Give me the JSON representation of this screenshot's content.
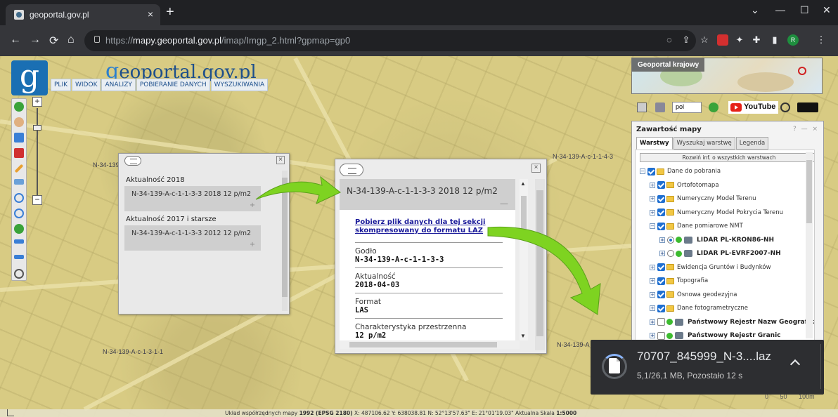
{
  "browser": {
    "tab_title": "geoportal.gov.pl",
    "tab_close": "×",
    "new_tab": "+",
    "url_host": "mapy.geoportal.gov.pl",
    "url_prefix": "https://",
    "url_path": "/imap/Imgp_2.html?gpmap=gp0",
    "win_controls": [
      "⌄",
      "—",
      "☐",
      "✕"
    ],
    "profile_letter": "R"
  },
  "site": {
    "logo_letter": "g",
    "title_g": "g",
    "title_rest": "eoportal.gov.pl",
    "menu": [
      "PLIK",
      "WIDOK",
      "ANALIZY",
      "POBIERANIE DANYCH",
      "WYSZUKIWANIA"
    ]
  },
  "map": {
    "sheet_labels": [
      "N-34-139",
      "N-34-139-A-c-1-1-4-3",
      "N-34-139-A-c-1-3-1-1",
      "N-34-139-A"
    ],
    "status_text_parts": {
      "prefix": "Układ współrzędnych mapy ",
      "system": "1992 (EPSG 2180)",
      "coords": "  X: 487106.62 Y: 638038.81   N: 52°13'57.63\" E: 21°01'19.03\"  Aktualna Skala ",
      "scale": "1:5000"
    },
    "scale_ticks": [
      "0",
      "50",
      "100m"
    ]
  },
  "popup1": {
    "section1": "Aktualność 2018",
    "item1": "N-34-139-A-c-1-1-3-3 2018 12 p/m2",
    "section2": "Aktualność 2017 i starsze",
    "item2": "N-34-139-A-c-1-1-3-3 2012 12 p/m2",
    "plus": "+",
    "close": "×"
  },
  "popup2": {
    "header": "N-34-139-A-c-1-1-3-3 2018 12 p/m2",
    "minus": "—",
    "close": "×",
    "download_link": "Pobierz plik danych dla tej sekcji skompresowany do formatu LAZ",
    "fields": [
      {
        "label": "Godło",
        "value": "N-34-139-A-c-1-1-3-3"
      },
      {
        "label": "Aktualność",
        "value": "2018-04-03"
      },
      {
        "label": "Format",
        "value": "LAS"
      },
      {
        "label": "Charakterystyka przestrzenna",
        "value": "12 p/m2"
      }
    ]
  },
  "right_panel": {
    "ref_map_title": "Geoportal krajowy",
    "lang_select": "pol",
    "youtube": "YouTube",
    "content_title": "Zawartość mapy",
    "content_window_controls": "? — ×",
    "tabs": [
      "Warstwy",
      "Wyszukaj warstwę",
      "Legenda"
    ],
    "expand_button": "Rozwiń inf. o wszystkich warstwach",
    "tree": [
      {
        "label": "Dane do pobrania",
        "pm": "−",
        "level": 0,
        "type": "folder",
        "checked": true
      },
      {
        "label": "Ortofotomapa",
        "pm": "+",
        "level": 1,
        "type": "folder",
        "checked": true
      },
      {
        "label": "Numeryczny Model Terenu",
        "pm": "+",
        "level": 1,
        "type": "folder",
        "checked": true
      },
      {
        "label": "Numeryczny Model Pokrycia Terenu",
        "pm": "+",
        "level": 1,
        "type": "folder",
        "checked": true
      },
      {
        "label": "Dane pomiarowe NMT",
        "pm": "−",
        "level": 1,
        "type": "folder",
        "checked": true
      },
      {
        "label": "LIDAR PL-KRON86-NH",
        "pm": "+",
        "level": 2,
        "type": "radio-on"
      },
      {
        "label": "LIDAR PL-EVRF2007-NH",
        "pm": "+",
        "level": 2,
        "type": "radio-off"
      },
      {
        "label": "Ewidencja Gruntów i Budynków",
        "pm": "+",
        "level": 1,
        "type": "folder",
        "checked": true
      },
      {
        "label": "Topografia",
        "pm": "+",
        "level": 1,
        "type": "folder",
        "checked": true
      },
      {
        "label": "Osnowa geodezyjna",
        "pm": "+",
        "level": 1,
        "type": "folder",
        "checked": true
      },
      {
        "label": "Dane fotogrametryczne",
        "pm": "+",
        "level": 1,
        "type": "folder",
        "checked": true
      },
      {
        "label": "Państwowy Rejestr Nazw Geograficzny",
        "pm": "+",
        "level": 1,
        "type": "layer-off"
      },
      {
        "label": "Państwowy Rejestr Granic",
        "pm": "+",
        "level": 1,
        "type": "layer-off"
      }
    ]
  },
  "download": {
    "filename": "70707_845999_N-3....laz",
    "status": "5,1/26,1 MB, Pozostało 12 s"
  },
  "colors": {
    "arrow_green": "#7ed321",
    "link_blue": "#1a1a9a",
    "checkbox_blue": "#1f6fd1"
  }
}
